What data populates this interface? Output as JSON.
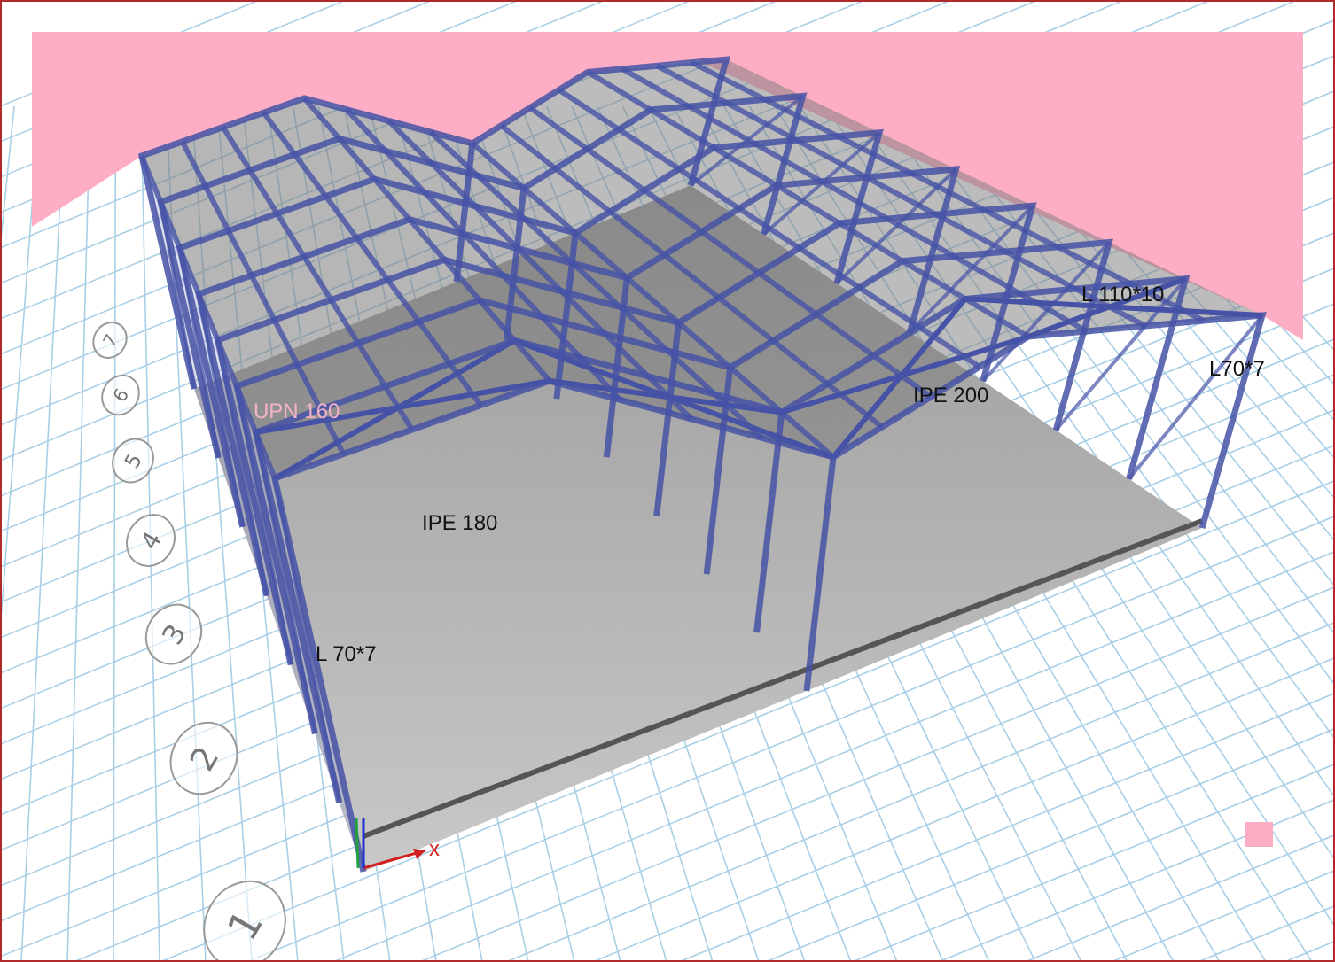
{
  "model_view": {
    "section_labels": [
      {
        "text": "UPN 160",
        "kind": "highlighted"
      },
      {
        "text": "IPE 180",
        "kind": "normal"
      },
      {
        "text": "L 70*7",
        "kind": "normal"
      },
      {
        "text": "IPE 200",
        "kind": "normal"
      },
      {
        "text": "L 110*10",
        "kind": "normal"
      },
      {
        "text": "L70*7",
        "kind": "normal"
      }
    ],
    "grid_bubbles": [
      "1",
      "2",
      "3",
      "4",
      "5",
      "6",
      "7"
    ],
    "axis_label": "x"
  }
}
